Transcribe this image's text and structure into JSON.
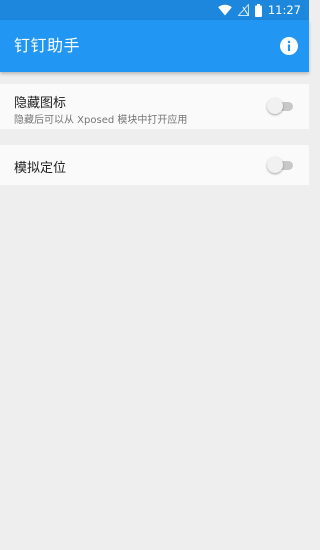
{
  "status_bar": {
    "time": "11:27",
    "icons": [
      "wifi-icon",
      "no-signal-icon",
      "battery-icon"
    ]
  },
  "app_bar": {
    "title": "钉钉助手",
    "info_icon": "info-icon"
  },
  "settings": {
    "hide_icon": {
      "title": "隐藏图标",
      "summary": "隐藏后可以从 Xposed 模块中打开应用",
      "enabled": false
    },
    "mock_location": {
      "title": "模拟定位",
      "enabled": false
    }
  },
  "colors": {
    "status_bar": "#1c87dc",
    "app_bar": "#2196f3",
    "background": "#eeeeee",
    "card": "#fafafa",
    "switch_off_track": "#c8c8c8",
    "switch_off_thumb": "#f1f1f1"
  }
}
